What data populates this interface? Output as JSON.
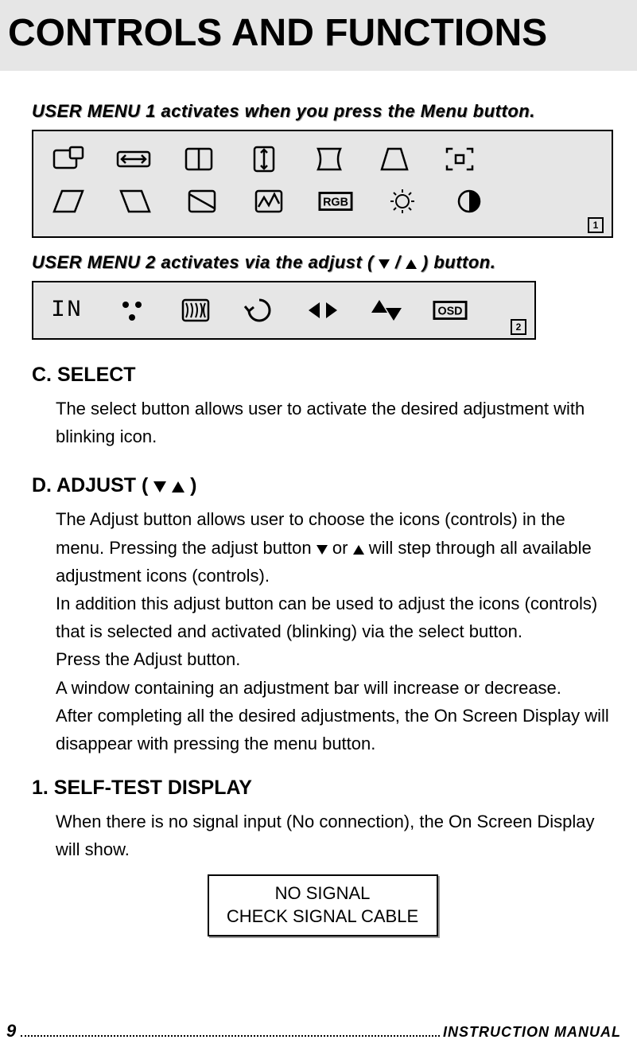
{
  "title": "CONTROLS AND FUNCTIONS",
  "menu1_heading_pre": "USER MENU 1 activates when you press the Menu button.",
  "menu2_heading_pre": "USER MENU 2 activates via the adjust (",
  "menu2_heading_post": ") button.",
  "panel1_number": "1",
  "panel2_number": "2",
  "panel2_in": "IN",
  "rgb_label": "RGB",
  "osd_label": "OSD",
  "sectionC": {
    "heading": "C. SELECT",
    "body": "The select button allows user to activate the desired adjustment with blinking icon."
  },
  "sectionD": {
    "heading_pre": "D. ADJUST (",
    "heading_post": ")",
    "p1_pre": "The Adjust button allows user to choose the icons (controls) in the menu. Pressing the adjust button ",
    "p1_mid": "or ",
    "p1_post": "will step through all available adjustment icons (controls).",
    "p2": "In addition this adjust button can be used to adjust the icons (controls) that is selected and activated (blinking) via the select button.",
    "p3": "Press the Adjust button.",
    "p4": "A window containing an adjustment bar will increase or decrease.",
    "p5": "After completing all the desired adjustments, the On Screen Display will disappear with pressing the menu button."
  },
  "section1": {
    "heading": "1. SELF-TEST DISPLAY",
    "body": "When there is no signal input (No connection), the On Screen Display will show."
  },
  "no_signal": {
    "line1": "NO SIGNAL",
    "line2": "CHECK SIGNAL CABLE"
  },
  "footer": {
    "page": "9",
    "label": "INSTRUCTION  MANUAL"
  }
}
